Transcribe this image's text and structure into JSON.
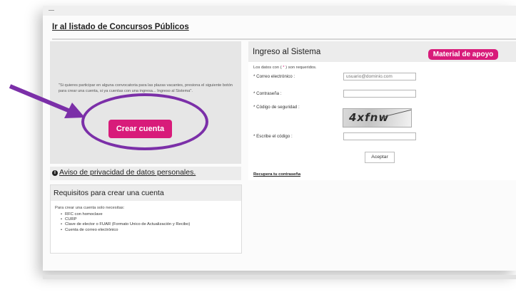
{
  "header": {
    "list_link": "Ir al listado de Concursos Públicos"
  },
  "left": {
    "intro_text": "\"Si quieres participar en alguna convocatoria para las plazas vacantes, presiona el siguiente botón para crear una cuenta, si ya cuentas con una ingresa... Ingreso al Sistema\".",
    "create_button": "Crear cuenta",
    "privacy_link": "Aviso de privacidad de datos personales."
  },
  "requirements": {
    "title": "Requisitos para crear una cuenta",
    "intro": "Para crear una cuenta solo necesitas:",
    "items": [
      "RFC con homoclave",
      "CURP",
      "Clave de elector o FUAR (Formato Unico de Actualización y Recibo)",
      "Cuenta de correo electrónico"
    ]
  },
  "login": {
    "title": "Ingreso al Sistema",
    "material_button": "Material de apoyo",
    "required_prefix": "Los datos con (",
    "required_star": "*",
    "required_suffix": ") son requeridos.",
    "email_label": "* Correo electrónico :",
    "email_placeholder": "usuario@dominio.com",
    "password_label": "* Contraseña :",
    "security_label": "* Código de seguridad :",
    "captcha_text": "4xfnw",
    "code_label": "* Escribe el código :",
    "accept_button": "Aceptar",
    "recover_link": "Recupera tu contraseña"
  },
  "colors": {
    "accent": "#d81b7a",
    "annotation": "#7b2fa8"
  }
}
